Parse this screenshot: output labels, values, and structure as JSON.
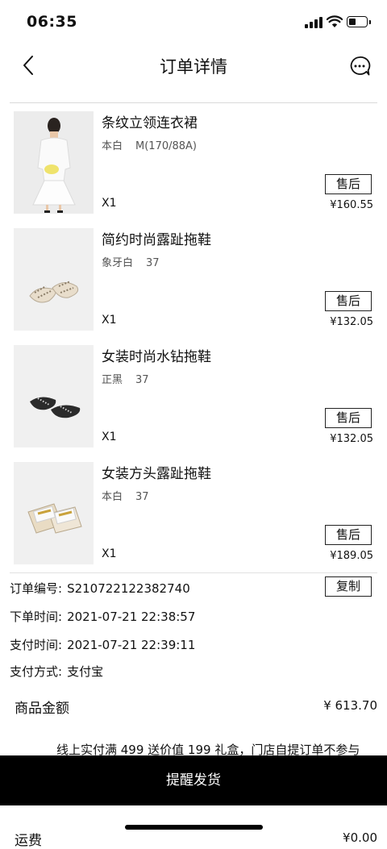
{
  "status_bar": {
    "time": "06:35"
  },
  "nav": {
    "title": "订单详情"
  },
  "items": [
    {
      "name": "条纹立领连衣裙",
      "color": "本白",
      "size": "M(170/88A)",
      "qty": "X1",
      "after_sale": "售后",
      "price": "¥160.55"
    },
    {
      "name": "简约时尚露趾拖鞋",
      "color": "象牙白",
      "size": "37",
      "qty": "X1",
      "after_sale": "售后",
      "price": "¥132.05"
    },
    {
      "name": "女装时尚水钻拖鞋",
      "color": "正黑",
      "size": "37",
      "qty": "X1",
      "after_sale": "售后",
      "price": "¥132.05"
    },
    {
      "name": "女装方头露趾拖鞋",
      "color": "本白",
      "size": "37",
      "qty": "X1",
      "after_sale": "售后",
      "price": "¥189.05"
    }
  ],
  "order": {
    "number_label": "订单编号:",
    "number": "S210722122382740",
    "copy": "复制",
    "placed_label": "下单时间:",
    "placed": "2021-07-21 22:38:57",
    "paid_label": "支付时间:",
    "paid": "2021-07-21 22:39:11",
    "method_label": "支付方式:",
    "method": "支付宝"
  },
  "summary": {
    "goods_label": "商品金额",
    "goods_value": "¥ 613.70",
    "promo": "线上实付满 499 送价值 199 礼盒，门店自提订单不参与",
    "freight_label": "运费",
    "freight_value": "¥0.00"
  },
  "bottom": {
    "remind": "提醒发货"
  },
  "icons": {
    "back": "chevron-left-icon",
    "chat": "chat-bubble-icon"
  }
}
